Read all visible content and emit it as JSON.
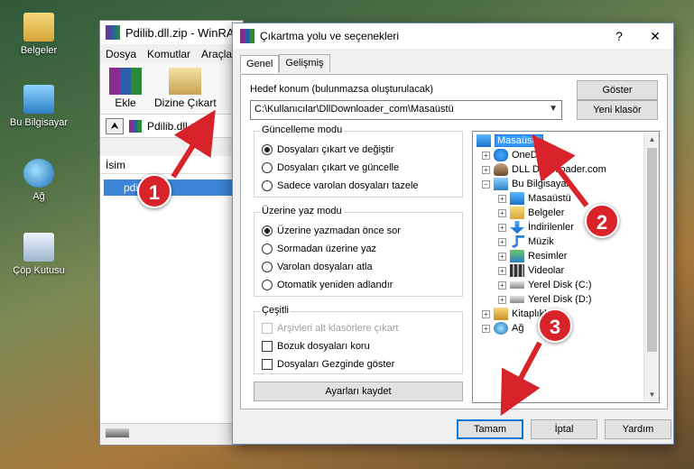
{
  "desktop": {
    "icons": [
      {
        "label": "Belgeler",
        "icon": "documents-folder-icon"
      },
      {
        "label": "Bu Bilgisayar",
        "icon": "computer-icon"
      },
      {
        "label": "Ağ",
        "icon": "network-icon"
      },
      {
        "label": "Çöp Kutusu",
        "icon": "recycle-bin-icon"
      }
    ]
  },
  "winrar": {
    "title": "Pdilib.dll.zip - WinRAR",
    "menu": [
      "Dosya",
      "Komutlar",
      "Araçlar"
    ],
    "toolbar": {
      "add": "Ekle",
      "extract": "Dizine Çıkart"
    },
    "path": "Pdilib.dll.zip",
    "list_header": "İsim",
    "list_row": "pdilib.dll"
  },
  "dialog": {
    "title": "Çıkartma yolu ve seçenekleri",
    "help": "?",
    "close": "✕",
    "tabs": [
      "Genel",
      "Gelişmiş"
    ],
    "dest_label": "Hedef konum (bulunmazsa oluşturulacak)",
    "dest_value": "C:\\Kullanıcılar\\DllDownloader_com\\Masaüstü",
    "show_btn": "Göster",
    "new_folder_btn": "Yeni klasör",
    "update_group": {
      "title": "Güncelleme modu",
      "options": [
        "Dosyaları çıkart ve değiştir",
        "Dosyaları çıkart ve güncelle",
        "Sadece varolan dosyaları tazele"
      ],
      "selected": 0
    },
    "overwrite_group": {
      "title": "Üzerine yaz modu",
      "options": [
        "Üzerine yazmadan önce sor",
        "Sormadan üzerine yaz",
        "Varolan dosyaları atla",
        "Otomatik yeniden adlandır"
      ],
      "selected": 0
    },
    "misc_group": {
      "title": "Çeşitli",
      "options": [
        "Arşivleri alt klasörlere çıkart",
        "Bozuk dosyaları koru",
        "Dosyaları Gezginde göster"
      ]
    },
    "save_settings_btn": "Ayarları kaydet",
    "tree": [
      {
        "label": "Masaüstü",
        "icon": "desktop-icon",
        "level": 0,
        "selected": true
      },
      {
        "label": "OneDrive",
        "icon": "cloud-icon",
        "level": 1
      },
      {
        "label": "DLL Downloader.com",
        "icon": "user-icon",
        "level": 1
      },
      {
        "label": "Bu Bilgisayar",
        "icon": "computer-icon",
        "level": 1
      },
      {
        "label": "Masaüstü",
        "icon": "desktop-icon",
        "level": 2
      },
      {
        "label": "Belgeler",
        "icon": "folder-icon",
        "level": 2
      },
      {
        "label": "İndirilenler",
        "icon": "download-icon",
        "level": 2
      },
      {
        "label": "Müzik",
        "icon": "music-icon",
        "level": 2
      },
      {
        "label": "Resimler",
        "icon": "pictures-icon",
        "level": 2
      },
      {
        "label": "Videolar",
        "icon": "video-icon",
        "level": 2
      },
      {
        "label": "Yerel Disk (C:)",
        "icon": "disk-icon",
        "level": 2
      },
      {
        "label": "Yerel Disk (D:)",
        "icon": "disk-icon",
        "level": 2
      },
      {
        "label": "Kitaplıklar",
        "icon": "library-icon",
        "level": 1
      },
      {
        "label": "Ağ",
        "icon": "network-icon",
        "level": 1
      }
    ],
    "ok_btn": "Tamam",
    "cancel_btn": "İptal",
    "help_btn": "Yardım"
  },
  "annotations": [
    {
      "number": "1"
    },
    {
      "number": "2"
    },
    {
      "number": "3"
    }
  ],
  "colors": {
    "selection": "#3399ff",
    "badge": "#d8232a",
    "accent": "#0078d7"
  }
}
